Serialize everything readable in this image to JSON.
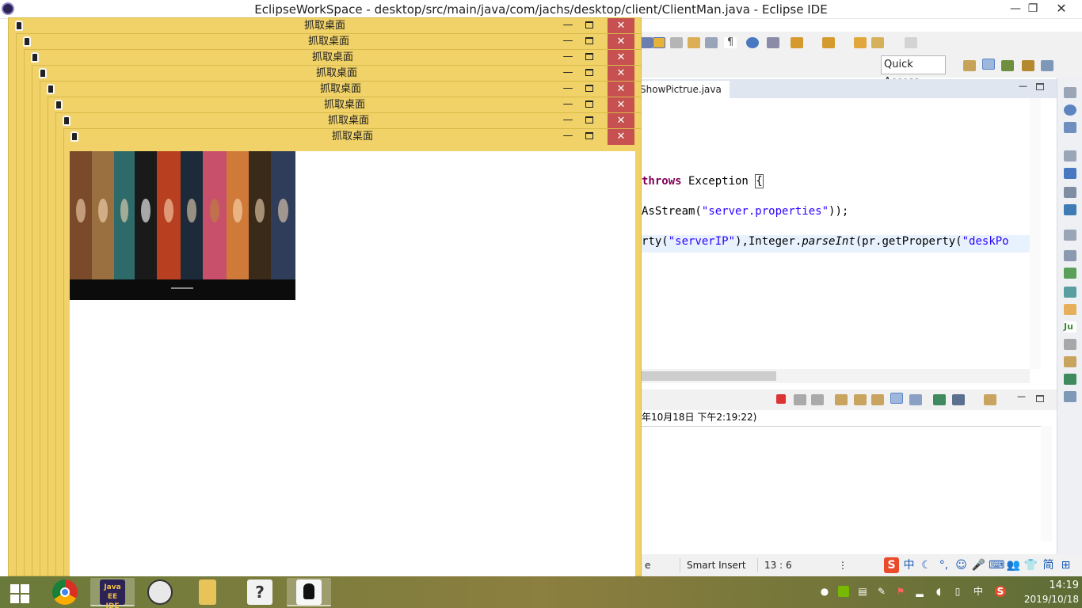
{
  "eclipse": {
    "window_title": "EclipseWorkSpace - desktop/src/main/java/com/jachs/desktop/client/ClientMan.java - Eclipse IDE",
    "controls": {
      "minimize": "—",
      "restore": "❐",
      "close": "✕"
    },
    "quick_access_placeholder": "Quick Access",
    "editor_tab": "ShowPictrue.java",
    "code": {
      "line1_kw": "throws",
      "line1_rest": " Exception ",
      "line1_brace": "{",
      "line2_a": "AsStream(",
      "line2_s": "\"server.properties\"",
      "line2_b": "));",
      "line3_a": "rty(",
      "line3_s1": "\"serverIP\"",
      "line3_b": "),Integer.",
      "line3_it": "parseInt",
      "line3_c": "(pr.getProperty(",
      "line3_s2": "\"deskPo"
    },
    "console_header": "年10月18日 下午2:19:22)",
    "status": {
      "cell1": "e",
      "insert_mode": "Smart Insert",
      "cursor_pos": "13 : 6",
      "dots": "⋮"
    },
    "ime": [
      "中",
      "☾",
      "°,",
      "☺",
      "🎤",
      "⌨",
      "👥",
      "👕",
      "简",
      "⊞"
    ]
  },
  "capture_windows": {
    "title": "抓取桌面",
    "close_glyph": "✕",
    "minimize_glyph": "—",
    "count": 8
  },
  "taskbar": {
    "apps": [
      {
        "name": "chrome",
        "icon": "chrome-icon"
      },
      {
        "name": "Java EE IDE",
        "label": "Java EE IDE",
        "icon": "eclipse-icon"
      },
      {
        "name": "manga-app",
        "icon": "manga-icon"
      },
      {
        "name": "file-explorer",
        "icon": "folder-icon"
      },
      {
        "name": "help",
        "icon": "help-icon",
        "label": "?"
      },
      {
        "name": "capture-app",
        "icon": "capture-icon"
      }
    ],
    "tray": {
      "ime": "中",
      "sogou": "S"
    },
    "clock": {
      "time": "14:19",
      "date": "2019/10/18"
    }
  },
  "colors": {
    "capture_window": "#f0d268",
    "close_button": "#c75050",
    "keyword": "#7f0055",
    "string": "#2a00ff"
  }
}
